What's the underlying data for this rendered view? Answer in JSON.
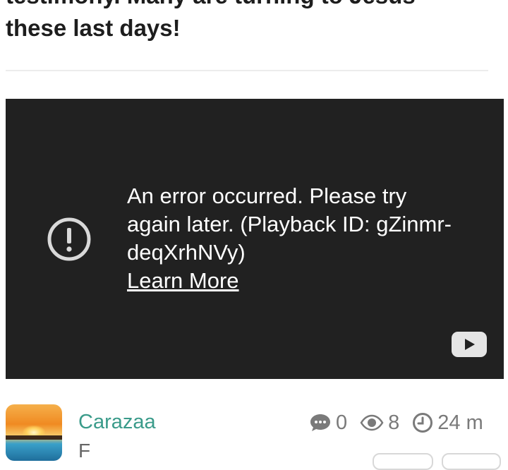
{
  "post": {
    "title_line1_partial": "testimony. Many are turning to Jesus",
    "title_line2": "these last days!"
  },
  "video": {
    "error_message": "An error occurred. Please try again later. (Playback ID: gZinmr-deqXrhNVy)",
    "learn_more": "Learn More",
    "icons": {
      "error": "exclamation-circle-icon",
      "player_logo": "youtube-icon"
    }
  },
  "author": {
    "name": "Carazaa",
    "sub": "F"
  },
  "stats": {
    "comments": "0",
    "views": "8",
    "time": "24 m"
  },
  "colors": {
    "video_bg": "#212121",
    "username": "#3a9b8a",
    "stat": "#7a7a7a"
  }
}
